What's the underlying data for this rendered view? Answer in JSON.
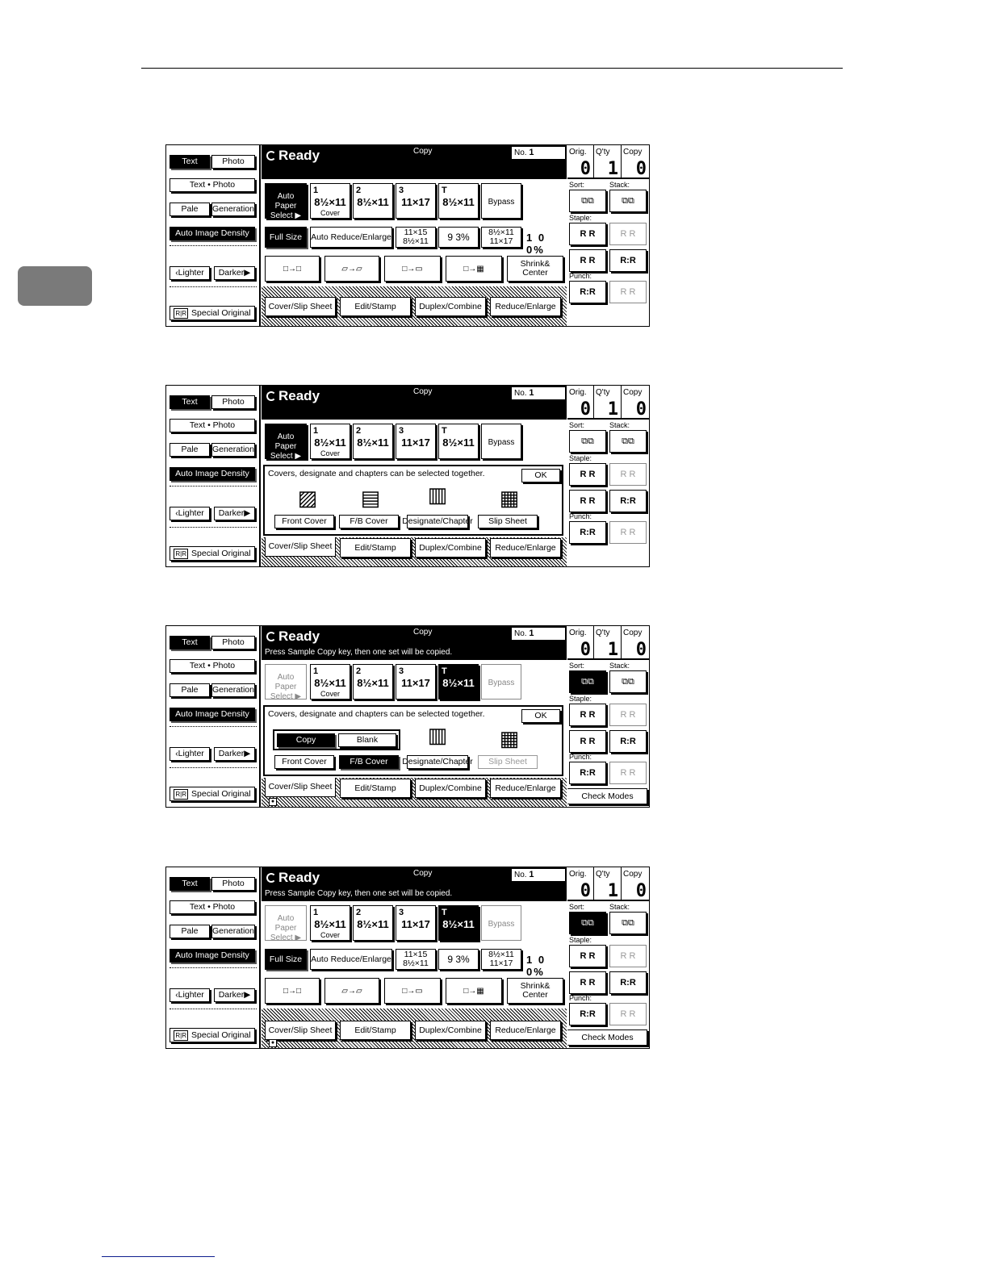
{
  "common": {
    "left": {
      "text": "Text",
      "photo": "Photo",
      "text_photo": "Text • Photo",
      "pale": "Pale",
      "generation": "Generation",
      "auto_density": "Auto Image Density",
      "lighter": "‹Lighter",
      "darker": "Darker▶",
      "special_original": "Special Original"
    },
    "header": {
      "ready": "Ready",
      "copy": "Copy",
      "no_label": "No.",
      "no_value": "1"
    },
    "counter": {
      "orig_label": "Orig.",
      "orig_value": "0",
      "qty_label": "Q'ty",
      "qty_value": "1",
      "copy_label": "Copy",
      "copy_value": "0"
    },
    "paper": {
      "auto_select": "Auto Paper Select ▶",
      "tray1_no": "1",
      "tray1_size": "8½×11",
      "tray1_sub": "Cover",
      "tray2_no": "2",
      "tray2_size": "8½×11",
      "tray3_no": "3",
      "tray3_size": "11×17",
      "trayt_no": "T",
      "trayt_size": "8½×11",
      "bypass": "Bypass"
    },
    "size": {
      "full_size": "Full Size",
      "auto_reduce": "Auto Reduce/Enlarge",
      "r1_top": "11×15",
      "r1_bot": "8½×11",
      "r2": "9 3%",
      "r3_top": "8½×11",
      "r3_bot": "11×17",
      "pct": "1 0 0%"
    },
    "modes": {
      "shrink_center": "Shrink& Center"
    },
    "tabs": {
      "cover_slip": "Cover/Slip Sheet",
      "edit_stamp": "Edit/Stamp",
      "duplex_combine": "Duplex/Combine",
      "reduce_enlarge": "Reduce/Enlarge"
    },
    "right": {
      "sort": "Sort:",
      "stack": "Stack:",
      "staple": "Staple:",
      "punch": "Punch:",
      "check_modes": "Check Modes"
    },
    "cover": {
      "message": "Covers, designate and chapters can be selected together.",
      "ok": "OK",
      "front_cover": "Front Cover",
      "fb_cover": "F/B Cover",
      "designate_chapter": "Designate/Chapter",
      "slip_sheet": "Slip Sheet",
      "copy": "Copy",
      "blank": "Blank"
    }
  },
  "screen3": {
    "submsg": "Press Sample Copy key, then one set will be copied."
  },
  "screen4": {
    "submsg": "Press Sample Copy key, then one set will be copied."
  }
}
